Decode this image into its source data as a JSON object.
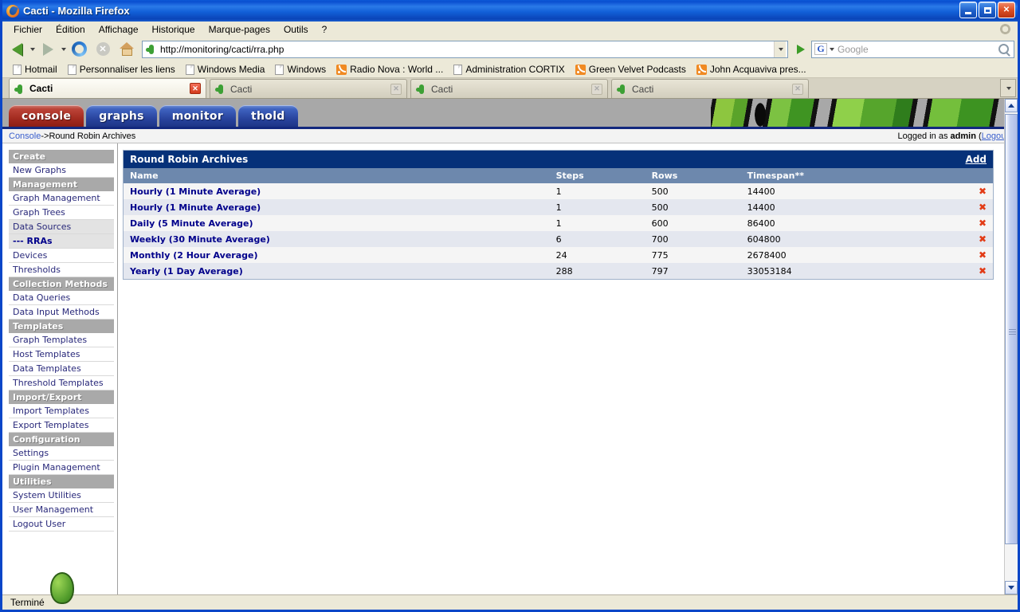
{
  "window": {
    "title": "Cacti - Mozilla Firefox",
    "icon": "firefox-icon",
    "minimize_label": "Minimize",
    "maximize_label": "Maximize",
    "close_label": "Close"
  },
  "menubar": {
    "items": [
      {
        "label": "Fichier",
        "accel": "F"
      },
      {
        "label": "Édition",
        "accel": "n"
      },
      {
        "label": "Affichage",
        "accel": "A"
      },
      {
        "label": "Historique",
        "accel": "H"
      },
      {
        "label": "Marque-pages",
        "accel": "M"
      },
      {
        "label": "Outils",
        "accel": "O"
      },
      {
        "label": "?",
        "accel": "?"
      }
    ]
  },
  "toolbar": {
    "back_label": "Back",
    "forward_label": "Forward",
    "reload_label": "Reload",
    "stop_label": "Stop",
    "home_label": "Home",
    "url": "http://monitoring/cacti/rra.php",
    "go_label": "Go",
    "search_engine": "G",
    "search_placeholder": "Google",
    "search_value": ""
  },
  "bookmarks": [
    {
      "label": "Hotmail",
      "icon": "page-icon"
    },
    {
      "label": "Personnaliser les liens",
      "icon": "page-icon"
    },
    {
      "label": "Windows Media",
      "icon": "page-icon"
    },
    {
      "label": "Windows",
      "icon": "page-icon"
    },
    {
      "label": "Radio Nova : World ...",
      "icon": "rss-icon"
    },
    {
      "label": "Administration CORTIX",
      "icon": "page-icon"
    },
    {
      "label": "Green Velvet Podcasts",
      "icon": "rss-icon"
    },
    {
      "label": "John Acquaviva pres...",
      "icon": "rss-icon"
    }
  ],
  "tabs": [
    {
      "label": "Cacti",
      "active": true
    },
    {
      "label": "Cacti",
      "active": false
    },
    {
      "label": "Cacti",
      "active": false
    },
    {
      "label": "Cacti",
      "active": false
    }
  ],
  "cacti": {
    "nav_tabs": [
      {
        "label": "console",
        "active": true
      },
      {
        "label": "graphs",
        "active": false
      },
      {
        "label": "monitor",
        "active": false
      },
      {
        "label": "thold",
        "active": false
      }
    ],
    "breadcrumb_link": "Console",
    "breadcrumb_sep": " -> ",
    "breadcrumb_current": "Round Robin Archives",
    "logged_in_prefix": "Logged in as ",
    "logged_in_user": "admin",
    "logout_open": " (",
    "logout_label": "Logout",
    "logout_close": ")",
    "sidebar": [
      {
        "type": "header",
        "label": "Create"
      },
      {
        "type": "item",
        "label": "New Graphs",
        "state": "normal"
      },
      {
        "type": "header",
        "label": "Management"
      },
      {
        "type": "item",
        "label": "Graph Management",
        "state": "normal"
      },
      {
        "type": "item",
        "label": "Graph Trees",
        "state": "normal"
      },
      {
        "type": "item",
        "label": "Data Sources",
        "state": "shaded"
      },
      {
        "type": "item",
        "label": "--- RRAs",
        "state": "current"
      },
      {
        "type": "item",
        "label": "Devices",
        "state": "normal"
      },
      {
        "type": "item",
        "label": "Thresholds",
        "state": "normal"
      },
      {
        "type": "header",
        "label": "Collection Methods"
      },
      {
        "type": "item",
        "label": "Data Queries",
        "state": "normal"
      },
      {
        "type": "item",
        "label": "Data Input Methods",
        "state": "normal"
      },
      {
        "type": "header",
        "label": "Templates"
      },
      {
        "type": "item",
        "label": "Graph Templates",
        "state": "normal"
      },
      {
        "type": "item",
        "label": "Host Templates",
        "state": "normal"
      },
      {
        "type": "item",
        "label": "Data Templates",
        "state": "normal"
      },
      {
        "type": "item",
        "label": "Threshold Templates",
        "state": "normal"
      },
      {
        "type": "header",
        "label": "Import/Export"
      },
      {
        "type": "item",
        "label": "Import Templates",
        "state": "normal"
      },
      {
        "type": "item",
        "label": "Export Templates",
        "state": "normal"
      },
      {
        "type": "header",
        "label": "Configuration"
      },
      {
        "type": "item",
        "label": "Settings",
        "state": "normal"
      },
      {
        "type": "item",
        "label": "Plugin Management",
        "state": "normal"
      },
      {
        "type": "header",
        "label": "Utilities"
      },
      {
        "type": "item",
        "label": "System Utilities",
        "state": "normal"
      },
      {
        "type": "item",
        "label": "User Management",
        "state": "normal"
      },
      {
        "type": "item",
        "label": "Logout User",
        "state": "normal"
      }
    ],
    "panel": {
      "title": "Round Robin Archives",
      "add_label": "Add",
      "columns": [
        "Name",
        "Steps",
        "Rows",
        "Timespan**"
      ],
      "rows": [
        {
          "name": "Hourly (1 Minute Average)",
          "steps": "1",
          "rows": "500",
          "timespan": "14400"
        },
        {
          "name": "Hourly (1 Minute Average)",
          "steps": "1",
          "rows": "500",
          "timespan": "14400"
        },
        {
          "name": "Daily (5 Minute Average)",
          "steps": "1",
          "rows": "600",
          "timespan": "86400"
        },
        {
          "name": "Weekly (30 Minute Average)",
          "steps": "6",
          "rows": "700",
          "timespan": "604800"
        },
        {
          "name": "Monthly (2 Hour Average)",
          "steps": "24",
          "rows": "775",
          "timespan": "2678400"
        },
        {
          "name": "Yearly (1 Day Average)",
          "steps": "288",
          "rows": "797",
          "timespan": "33053184"
        }
      ],
      "delete_icon": "delete-x-icon"
    }
  },
  "statusbar": {
    "text": "Terminé"
  },
  "colors": {
    "panel_title_bg": "#063179",
    "column_header_bg": "#6d88ad",
    "link": "#00008b",
    "delete": "#e23b16",
    "active_nav_tab": "#a32b20",
    "nav_tab": "#29449e"
  }
}
